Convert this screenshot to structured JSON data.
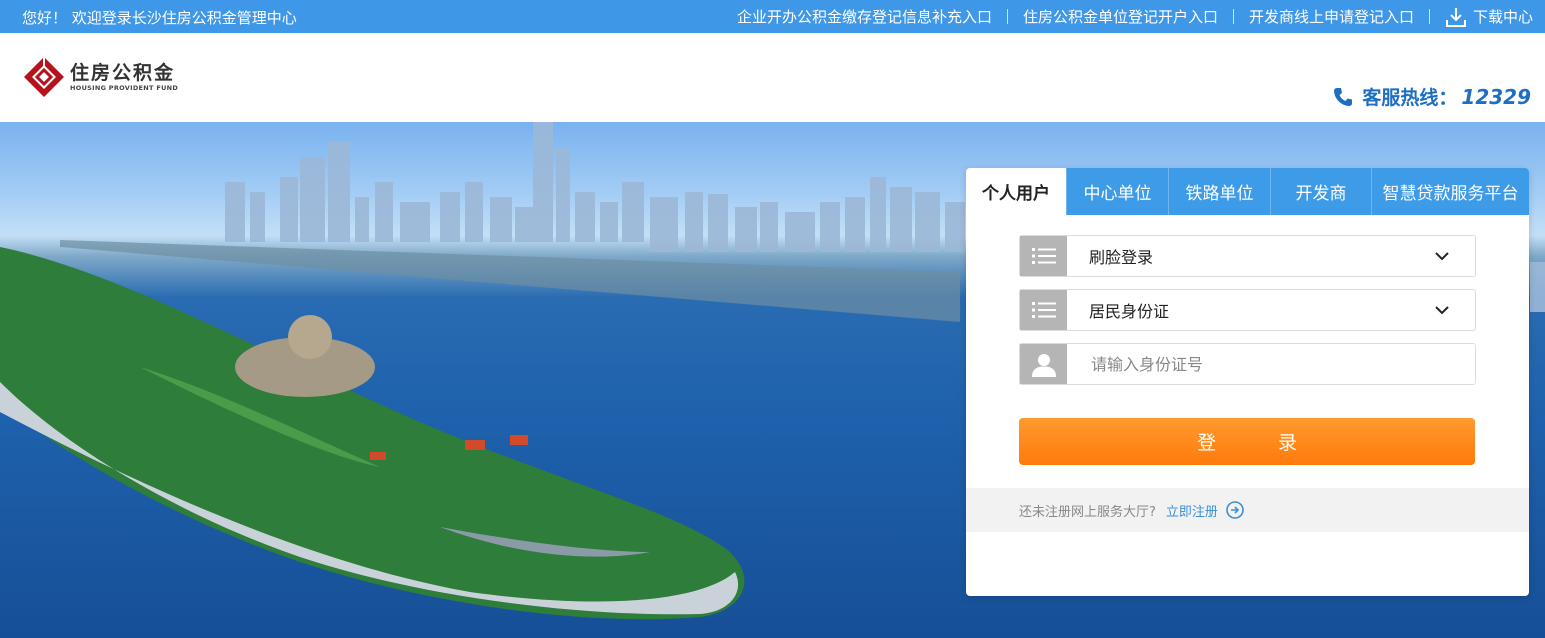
{
  "topbar": {
    "welcome": "您好！ 欢迎登录长沙住房公积金管理中心",
    "links": [
      "企业开办公积金缴存登记信息补充入口",
      "住房公积金单位登记开户入口",
      "开发商线上申请登记入口"
    ],
    "download": "下载中心"
  },
  "header": {
    "logo_cn": "住房公积金",
    "logo_en": "HOUSING PROVIDENT FUND",
    "hotline_label": "客服热线：",
    "hotline_number": "12329"
  },
  "login": {
    "tabs": [
      "个人用户",
      "中心单位",
      "铁路单位",
      "开发商",
      "智慧贷款服务平台"
    ],
    "active_tab": 0,
    "login_method": "刷脸登录",
    "id_type": "居民身份证",
    "id_input_placeholder": "请输入身份证号",
    "login_button": "登 录",
    "register_question": "还未注册网上服务大厅?",
    "register_link": "立即注册"
  },
  "colors": {
    "topbar": "#3f97e8",
    "accent": "#3d9be8",
    "login_button": "#ff8a1c",
    "hotline": "#1e6fc3"
  }
}
